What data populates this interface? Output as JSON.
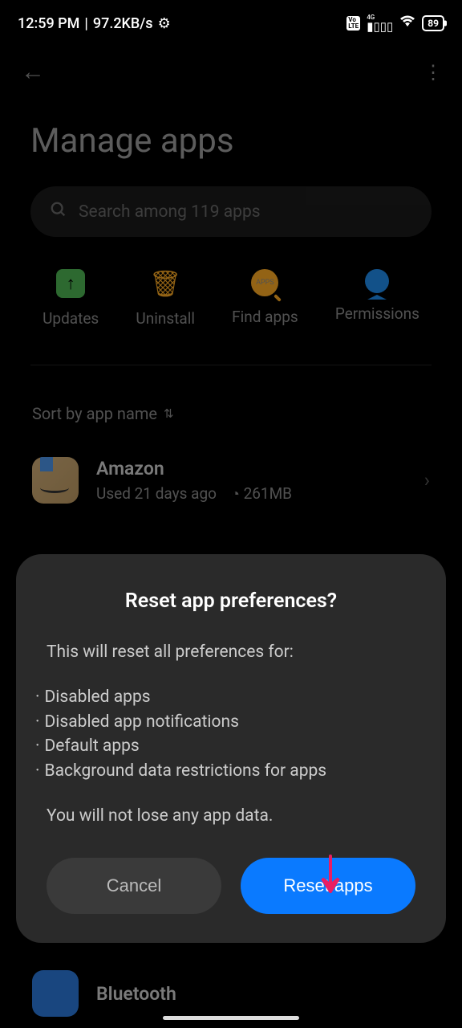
{
  "status": {
    "time": "12:59 PM",
    "speed": "97.2KB/s",
    "battery": "89",
    "network_type": "4G",
    "volte": "Vo LTE"
  },
  "page": {
    "title": "Manage apps"
  },
  "search": {
    "placeholder": "Search among 119 apps"
  },
  "actions": {
    "updates": "Updates",
    "uninstall": "Uninstall",
    "find_apps": "Find apps",
    "permissions": "Permissions",
    "findapps_badge": "APPS"
  },
  "sort": {
    "label": "Sort by app name"
  },
  "apps": [
    {
      "name": "Amazon",
      "usage": "Used 21 days ago",
      "size": "261MB"
    },
    {
      "name": "Bluetooth",
      "usage": "",
      "size": ""
    }
  ],
  "dialog": {
    "title": "Reset app preferences?",
    "intro": "This will reset all preferences for:",
    "items": [
      "Disabled apps",
      "Disabled app notifications",
      "Default apps",
      "Background data restrictions for apps"
    ],
    "footer": "You will not lose any app data.",
    "cancel": "Cancel",
    "confirm": "Reset apps"
  }
}
